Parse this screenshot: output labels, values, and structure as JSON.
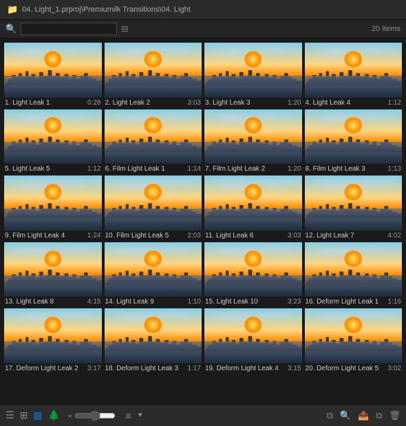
{
  "titleBar": {
    "icon": "folder-icon",
    "path": "04. Light_1.prproj\\Premiumilk Transitions\\04. Light"
  },
  "searchBar": {
    "placeholder": "",
    "filterIcon": "filter-icon",
    "itemCount": "20 Items"
  },
  "items": [
    {
      "id": 1,
      "name": "1. Light Leak 1",
      "duration": "0:28"
    },
    {
      "id": 2,
      "name": "2. Light Leak 2",
      "duration": "3:03"
    },
    {
      "id": 3,
      "name": "3. Light Leak 3",
      "duration": "1:20"
    },
    {
      "id": 4,
      "name": "4. Light Leak 4",
      "duration": "1:12"
    },
    {
      "id": 5,
      "name": "5. Light Leak 5",
      "duration": "1:12"
    },
    {
      "id": 6,
      "name": "6. Film Light Leak 1",
      "duration": "1:14"
    },
    {
      "id": 7,
      "name": "7. Film Light Leak 2",
      "duration": "1:20"
    },
    {
      "id": 8,
      "name": "8. Film Light Leak 3",
      "duration": "1:13"
    },
    {
      "id": 9,
      "name": "9. Film Light Leak 4",
      "duration": "1:24"
    },
    {
      "id": 10,
      "name": "10. Film Light Leak 5",
      "duration": "2:03"
    },
    {
      "id": 11,
      "name": "11. Light Leak 6",
      "duration": "3:03"
    },
    {
      "id": 12,
      "name": "12. Light Leak 7",
      "duration": "4:02"
    },
    {
      "id": 13,
      "name": "13. Light Leak 8",
      "duration": "4:15"
    },
    {
      "id": 14,
      "name": "14. Light Leak 9",
      "duration": "1:10"
    },
    {
      "id": 15,
      "name": "15. Light Leak 10",
      "duration": "3:23"
    },
    {
      "id": 16,
      "name": "16. Deform Light Leak 1",
      "duration": "1:16"
    },
    {
      "id": 17,
      "name": "17. Deform Light Leak 2",
      "duration": "3:17"
    },
    {
      "id": 18,
      "name": "18. Deform Light Leak 3",
      "duration": "1:17"
    },
    {
      "id": 19,
      "name": "19. Deform Light Leak 4",
      "duration": "3:15"
    },
    {
      "id": 20,
      "name": "20. Deform Light Leak 5",
      "duration": "3:02"
    }
  ],
  "bottomBar": {
    "listViewIcon": "list-view-icon",
    "gridViewIcon": "grid-view-icon",
    "tileViewIcon": "tile-view-icon",
    "treeViewIcon": "tree-view-icon",
    "searchIcon": "search-icon",
    "extractIcon": "extract-icon",
    "deleteIcon": "delete-icon",
    "sliderLabel": "size-slider"
  }
}
